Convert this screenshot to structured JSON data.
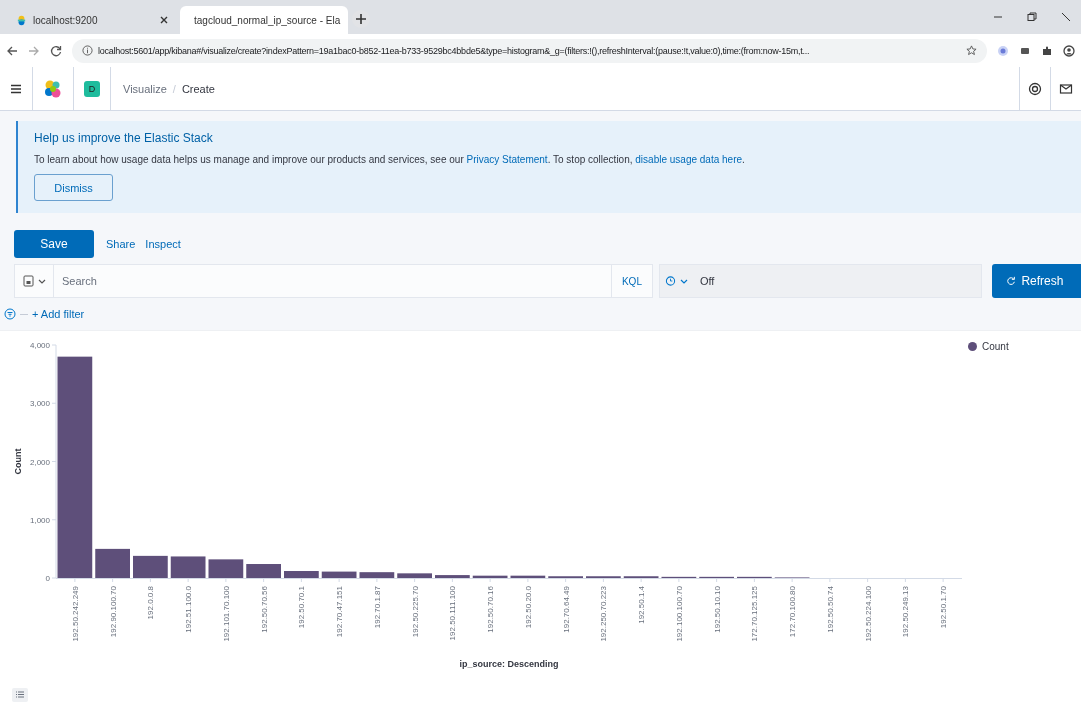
{
  "browser": {
    "tabs": [
      {
        "title": "localhost:9200",
        "kind": "elastic",
        "selected": false
      },
      {
        "title": "tagcloud_normal_ip_source - Ela",
        "kind": "kibana",
        "selected": true
      }
    ],
    "url": "localhost:5601/app/kibana#/visualize/create?indexPattern=19a1bac0-b852-11ea-b733-9529bc4bbde5&type=histogram&_g=(filters:!(),refreshInterval:(pause:!t,value:0),time:(from:now-15m,t..."
  },
  "header": {
    "avatar": "D",
    "separator": "/",
    "breadcrumbs": [
      {
        "label": "Visualize",
        "selected": false
      },
      {
        "label": "Create",
        "selected": true
      }
    ]
  },
  "callout": {
    "title": "Help us improve the Elastic Stack",
    "segments": [
      {
        "kind": "text",
        "text": "To learn about how usage data helps us manage and improve our products and services, see our "
      },
      {
        "kind": "link",
        "text": "Privacy Statement"
      },
      {
        "kind": "text",
        "text": ". To stop collection, "
      },
      {
        "kind": "link",
        "text": "disable usage data here"
      },
      {
        "kind": "text",
        "text": "."
      }
    ],
    "button": "Dismiss"
  },
  "toolbar": {
    "save": "Save",
    "links": [
      "Share",
      "Inspect"
    ]
  },
  "query": {
    "placeholder": "Search",
    "language": "KQL",
    "time": "Off",
    "refresh": "Refresh"
  },
  "filter": {
    "add": "+ Add filter"
  },
  "chart_data": {
    "type": "bar",
    "xlabel": "ip_source: Descending",
    "ylabel": "Count",
    "categories": [
      "192.50.242.249",
      "192.90.100.70",
      "192.0.0.8",
      "192.51.100.0",
      "192.101.70.100",
      "192.50.70.56",
      "192.50.70.1",
      "192.70.47.151",
      "192.70.1.87",
      "192.50.225.70",
      "192.50.111.100",
      "192.50.70.16",
      "192.50.20.0",
      "192.70.64.49",
      "192.250.70.223",
      "192.50.1.4",
      "192.100.100.70",
      "192.50.10.10",
      "172.70.125.125",
      "172.70.100.80",
      "192.50.50.74",
      "192.50.224.100",
      "192.50.249.13",
      "192.50.1.70"
    ],
    "series": [
      {
        "name": "Count",
        "color": "#5e4f7a",
        "values": [
          3800,
          500,
          380,
          370,
          320,
          240,
          120,
          110,
          100,
          80,
          50,
          40,
          40,
          30,
          30,
          30,
          20,
          20,
          20,
          10,
          null,
          null,
          null,
          null
        ]
      }
    ],
    "ylim": [
      0,
      4000
    ],
    "yticks": [
      {
        "value": 0,
        "label": "0"
      },
      {
        "value": 1000,
        "label": "1,000"
      },
      {
        "value": 2000,
        "label": "2,000"
      },
      {
        "value": 3000,
        "label": "3,000"
      },
      {
        "value": 4000,
        "label": "4,000"
      }
    ]
  }
}
